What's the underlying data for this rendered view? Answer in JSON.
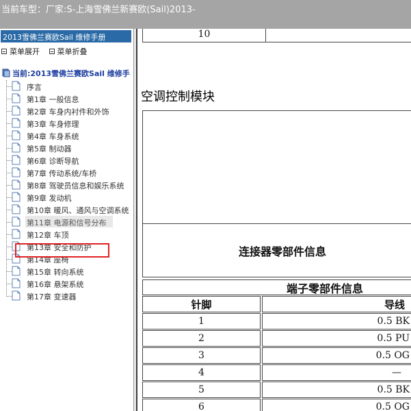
{
  "header": {
    "vehicle_label": "当前车型：",
    "vehicle_value": "厂家:S-上海雪佛兰新赛欧(Sail)2013-"
  },
  "sidebar": {
    "manual_title": "2013雪佛兰赛欧Sail 维修手册",
    "expand_label": "菜单展开",
    "collapse_label": "菜单折叠",
    "root_label": "当前:2013雪佛兰赛欧Sail 维修手",
    "items": [
      {
        "label": "序言"
      },
      {
        "label": "第1章 一般信息"
      },
      {
        "label": "第2章 车身内衬件和外饰"
      },
      {
        "label": "第3章 车身修理"
      },
      {
        "label": "第4章 车身系统"
      },
      {
        "label": "第5章 制动器"
      },
      {
        "label": "第6章 诊断导航"
      },
      {
        "label": "第7章 传动系统/车桥"
      },
      {
        "label": "第8章 驾驶员信息和娱乐系统"
      },
      {
        "label": "第9章 发动机"
      },
      {
        "label": "第10章 暖风、通风与空调系统"
      },
      {
        "label": "第11章 电源和信号分布"
      },
      {
        "label": "第12章 车顶"
      },
      {
        "label": "第13章 安全和防护"
      },
      {
        "label": "第14章 座椅"
      },
      {
        "label": "第15章 转向系统"
      },
      {
        "label": "第16章 悬架系统"
      },
      {
        "label": "第17章 变速器"
      }
    ],
    "selected_index": 11
  },
  "content": {
    "prev_row_number": "10",
    "section_title": "空调控制模块",
    "connector_info_title": "连接器零部件信息",
    "terminal_info_title": "端子零部件信息",
    "col_pin": "针脚",
    "col_wire": "导线",
    "rows": [
      {
        "pin": "1",
        "wire": "0.5 BK"
      },
      {
        "pin": "2",
        "wire": "0.5 PU"
      },
      {
        "pin": "3",
        "wire": "0.5 OG"
      },
      {
        "pin": "4",
        "wire": "—"
      },
      {
        "pin": "5",
        "wire": "0.5 BK"
      },
      {
        "pin": "6",
        "wire": "0.5 OG"
      }
    ]
  },
  "colors": {
    "topbar_bg": "#a5a5a5",
    "manual_title_bg": "#2a6aa6",
    "selection_frame": "#e02020"
  }
}
